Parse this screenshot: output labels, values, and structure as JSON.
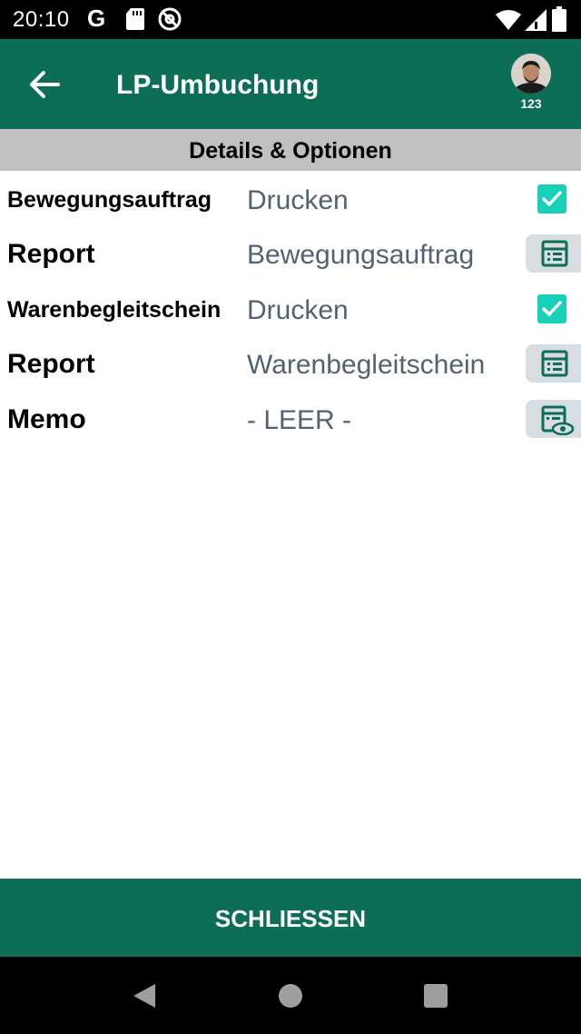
{
  "status_bar": {
    "time": "20:10",
    "google_letter": "G",
    "icons": [
      "sd-card-icon",
      "at-sign-icon",
      "wifi-icon",
      "signal-icon",
      "battery-icon"
    ]
  },
  "app_bar": {
    "title": "LP-Umbuchung",
    "back_icon": "arrow-left-icon",
    "avatar_badge": "123"
  },
  "section": {
    "title": "Details & Optionen"
  },
  "rows": [
    {
      "label": "Bewegungsauftrag",
      "value": "Drucken",
      "control": "checkbox",
      "checked": true
    },
    {
      "label": "Report",
      "value": "Bewegungsauftrag",
      "control": "list-icon-button"
    },
    {
      "label": "Warenbegleitschein",
      "value": "Drucken",
      "control": "checkbox",
      "checked": true
    },
    {
      "label": "Report",
      "value": "Warenbegleitschein",
      "control": "list-icon-button"
    },
    {
      "label": "Memo",
      "value": "- LEER -",
      "control": "memo-view-icon-button"
    }
  ],
  "footer": {
    "close_label": "SCHLIESSEN"
  },
  "colors": {
    "primary": "#0b6e55",
    "checkbox": "#16d1b8",
    "value_text": "#546173",
    "section_bg": "#c0c0c0",
    "button_bg": "#d8dde1"
  }
}
